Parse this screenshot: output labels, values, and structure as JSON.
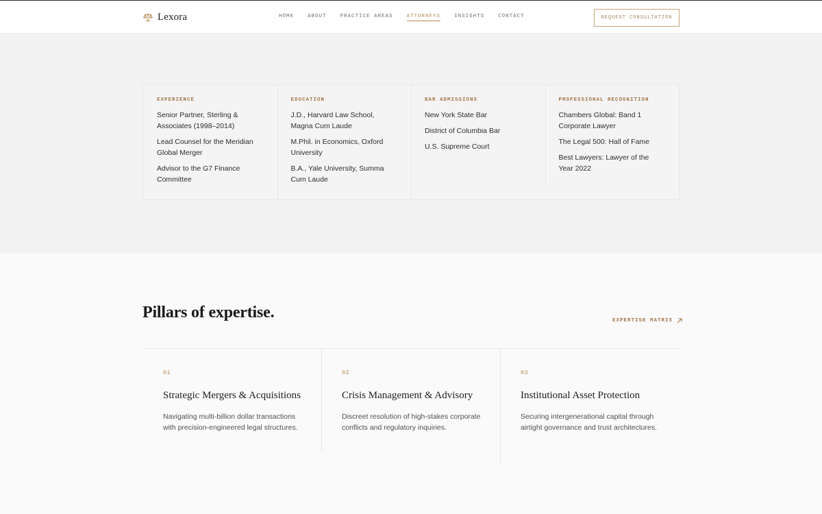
{
  "brand": {
    "name": "Lexora",
    "icon": "scales-icon",
    "accent": "#b58a55"
  },
  "nav": {
    "items": [
      {
        "label": "HOME",
        "active": false
      },
      {
        "label": "ABOUT",
        "active": false
      },
      {
        "label": "PRACTICE AREAS",
        "active": false
      },
      {
        "label": "ATTORNEYS",
        "active": true
      },
      {
        "label": "INSIGHTS",
        "active": false
      },
      {
        "label": "CONTACT",
        "active": false
      }
    ],
    "cta_label": "REQUEST CONSULTATION"
  },
  "credentials": {
    "columns": [
      {
        "title": "EXPERIENCE",
        "items": [
          "Senior Partner, Sterling & Associates (1998–2014)",
          "Lead Counsel for the Meridian Global Merger",
          "Advisor to the G7 Finance Committee"
        ]
      },
      {
        "title": "EDUCATION",
        "items": [
          "J.D., Harvard Law School, Magna Cum Laude",
          "M.Phil. in Economics, Oxford University",
          "B.A., Yale University, Summa Cum Laude"
        ]
      },
      {
        "title": "BAR ADMISSIONS",
        "items": [
          "New York State Bar",
          "District of Columbia Bar",
          "U.S. Supreme Court"
        ]
      },
      {
        "title": "PROFESSIONAL RECOGNITION",
        "items": [
          "Chambers Global: Band 1 Corporate Lawyer",
          "The Legal 500: Hall of Fame",
          "Best Lawyers: Lawyer of the Year 2022"
        ]
      }
    ]
  },
  "expertise": {
    "title": "Pillars of expertise.",
    "link_label": "EXPERTISE MATRIX",
    "link_icon": "arrow-up-right-icon",
    "pillars": [
      {
        "number": "01",
        "title": "Strategic Mergers & Acquisitions",
        "description": "Navigating multi-billion dollar transactions with precision-engineered legal structures."
      },
      {
        "number": "02",
        "title": "Crisis Management & Advisory",
        "description": "Discreet resolution of high-stakes corporate conflicts and regulatory inquiries."
      },
      {
        "number": "03",
        "title": "Institutional Asset Protection",
        "description": "Securing intergenerational capital through airtight governance and trust architectures."
      }
    ]
  }
}
